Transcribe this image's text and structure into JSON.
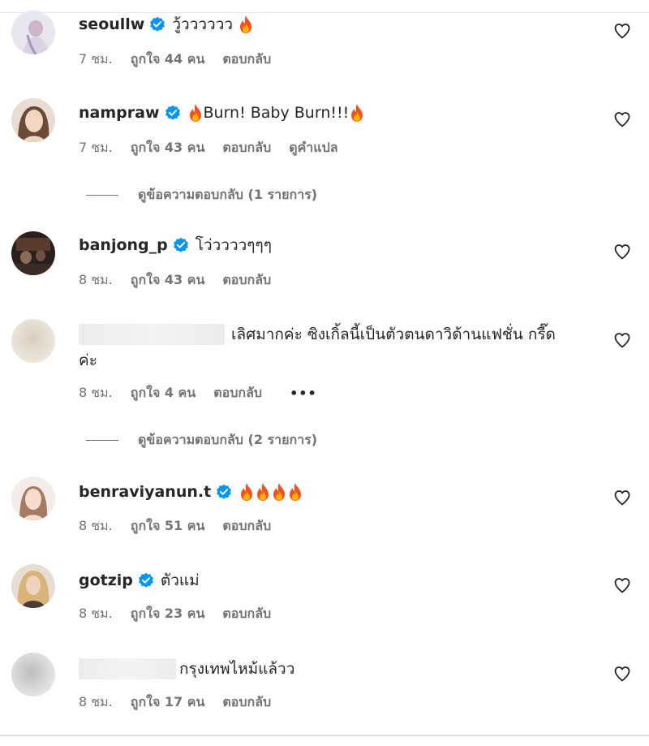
{
  "comments": [
    {
      "username": "seoullw",
      "text": "วู้วววววว",
      "fires": 1,
      "time": "7 ชม.",
      "likes": "ถูกใจ 44 คน",
      "reply": "ตอบกลับ"
    },
    {
      "username": "nampraw",
      "text": "Burn! Baby Burn!!!",
      "time": "7 ชม.",
      "likes": "ถูกใจ 43 คน",
      "reply": "ตอบกลับ",
      "translate": "ดูคำแปล",
      "view_replies": "ดูข้อความตอบกลับ (1 รายการ)"
    },
    {
      "username": "banjong_p",
      "text": "โว่ววววๆๆๆ",
      "time": "8 ชม.",
      "likes": "ถูกใจ 43 คน",
      "reply": "ตอบกลับ"
    },
    {
      "username": "",
      "text_line1": "เลิศมากค่ะ ซิงเกิ้ลนี้เป็นตัวตนดาวิด้านแฟชั่น กรี๊ด",
      "text_line2": "ค่ะ",
      "time": "8 ชม.",
      "likes": "ถูกใจ 4 คน",
      "reply": "ตอบกลับ",
      "more": "•••",
      "view_replies": "ดูข้อความตอบกลับ (2 รายการ)"
    },
    {
      "username": "benraviyanun.t",
      "fires": 4,
      "time": "8 ชม.",
      "likes": "ถูกใจ 51 คน",
      "reply": "ตอบกลับ"
    },
    {
      "username": "gotzip",
      "text": "ตัวแม่",
      "time": "8 ชม.",
      "likes": "ถูกใจ 23 คน",
      "reply": "ตอบกลับ"
    },
    {
      "username": "",
      "text": "กรุงเทพไหม้แล้วว",
      "time": "8 ชม.",
      "likes": "ถูกใจ 17 คน",
      "reply": "ตอบกลับ"
    }
  ],
  "colors": {
    "verified": "#0095f6",
    "meta": "#737373",
    "text": "#262626"
  },
  "icons": {
    "heart": "heart-icon",
    "verified": "verified-badge-icon",
    "fire": "fire-emoji-icon"
  }
}
